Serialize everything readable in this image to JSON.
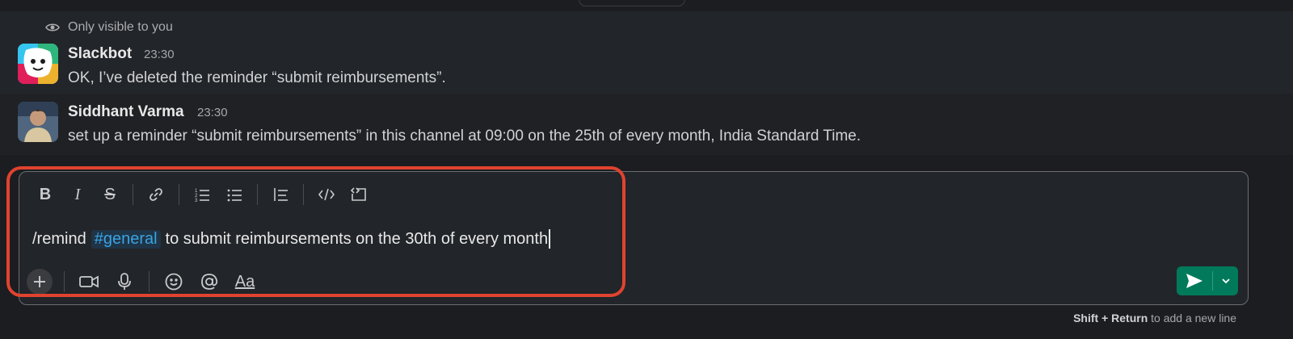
{
  "ephemeral": {
    "icon": "eye-icon",
    "label": "Only visible to you"
  },
  "messages": [
    {
      "author": "Slackbot",
      "time": "23:30",
      "text": "OK, I’ve deleted the reminder “submit reimbursements”.",
      "avatar_icon": "slackbot-avatar"
    },
    {
      "author": "Siddhant Varma",
      "time": "23:30",
      "text": "set up a reminder “submit reimbursements” in this channel at 09:00 on the 25th of every month, India Standard Time.",
      "avatar_icon": "user-avatar"
    }
  ],
  "composer": {
    "formatting_toolbar": [
      {
        "name": "bold-icon",
        "glyph": "B"
      },
      {
        "name": "italic-icon",
        "glyph": "I"
      },
      {
        "name": "strikethrough-icon",
        "glyph": "S"
      },
      {
        "name": "link-icon"
      },
      {
        "name": "ordered-list-icon"
      },
      {
        "name": "bulleted-list-icon"
      },
      {
        "name": "blockquote-icon"
      },
      {
        "name": "code-icon"
      },
      {
        "name": "code-block-icon"
      }
    ],
    "input": {
      "prefix": "/remind",
      "mention": "#general",
      "suffix": "to submit reimbursements on the 30th of every month"
    },
    "bottom_toolbar": [
      {
        "name": "plus-icon"
      },
      {
        "name": "video-icon"
      },
      {
        "name": "microphone-icon"
      },
      {
        "name": "emoji-icon"
      },
      {
        "name": "mention-icon"
      },
      {
        "name": "formatting-icon",
        "label": "Aa"
      }
    ],
    "send_button": {
      "icon": "send-icon",
      "dropdown_icon": "chevron-down-icon"
    }
  },
  "hint": {
    "keys": "Shift + Return",
    "text": "to add a new line"
  },
  "colors": {
    "background": "#1b1d21",
    "message_bg": "#222529",
    "accent_send": "#007a5a",
    "mention": "#3aa3e3",
    "highlight": "#e0432f"
  }
}
